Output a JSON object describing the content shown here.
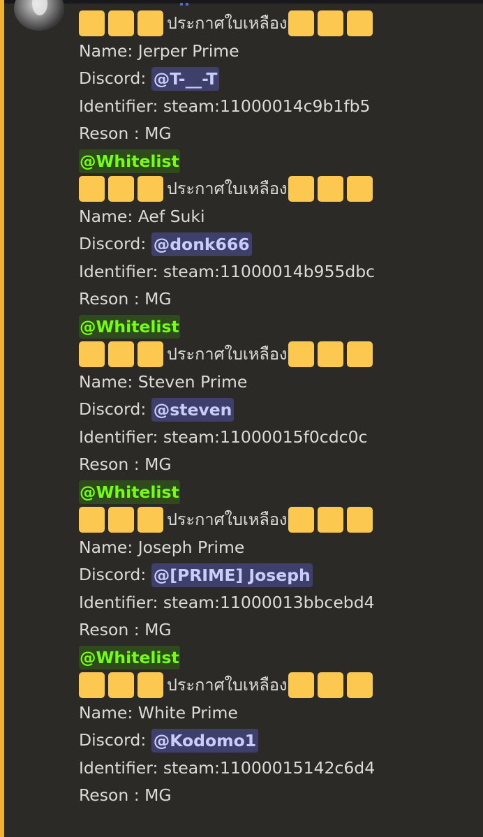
{
  "colors": {
    "background": "#2c2a26",
    "accent_bar": "#f0b232",
    "emoji_square": "#fcc850",
    "user_mention_bg": "#3f3f6c",
    "user_mention_text": "#c9cdfb",
    "role_mention_bg": "#2f4a1c",
    "role_mention_text": "#74ff12",
    "text": "#dcdcd6"
  },
  "icons": {
    "emoji": "yellow-square-emoji",
    "avatar": "user-avatar"
  },
  "labels": {
    "title": "ประกาศใบเหลือง",
    "name_prefix": "Name: ",
    "discord_prefix": "Discord: ",
    "identifier_prefix": "Identifier: ",
    "reason_prefix": "Reson : "
  },
  "entries": [
    {
      "name": "Jerper Prime",
      "discord": "@T-__-T",
      "identifier": "steam:11000014c9b1fb5",
      "reason": "MG",
      "role": "@Whitelist"
    },
    {
      "name": "Aef Suki",
      "discord": "@donk666",
      "identifier": "steam:11000014b955dbc",
      "reason": "MG",
      "role": "@Whitelist"
    },
    {
      "name": "Steven Prime",
      "discord": "@steven",
      "identifier": "steam:11000015f0cdc0c",
      "reason": "MG",
      "role": "@Whitelist"
    },
    {
      "name": "Joseph Prime",
      "discord": "@[PRIME] Joseph",
      "identifier": "steam:11000013bbcebd4",
      "reason": "MG",
      "role": "@Whitelist"
    },
    {
      "name": "White Prime",
      "discord": "@Kodomo1",
      "identifier": "steam:11000015142c6d4",
      "reason": "MG"
    }
  ]
}
